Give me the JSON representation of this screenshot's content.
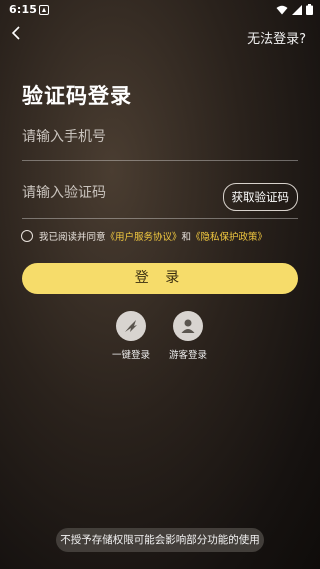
{
  "status_bar": {
    "time": "6:15"
  },
  "header": {
    "help_link": "无法登录?"
  },
  "page_title": "验证码登录",
  "phone_field": {
    "placeholder": "请输入手机号"
  },
  "code_field": {
    "placeholder": "请输入验证码",
    "get_code_label": "获取验证码"
  },
  "agreement": {
    "prefix": "我已阅读并同意",
    "user_agreement": "《用户服务协议》",
    "conjunction": "和",
    "privacy_policy": "《隐私保护政策》"
  },
  "login_button": "登 录",
  "alt_login": [
    {
      "label": "一键登录",
      "icon": "quick-login-icon"
    },
    {
      "label": "游客登录",
      "icon": "guest-icon"
    }
  ],
  "toast": "不授予存储权限可能会影响部分功能的使用",
  "colors": {
    "accent": "#f6dc6a",
    "link": "#f2c940"
  }
}
